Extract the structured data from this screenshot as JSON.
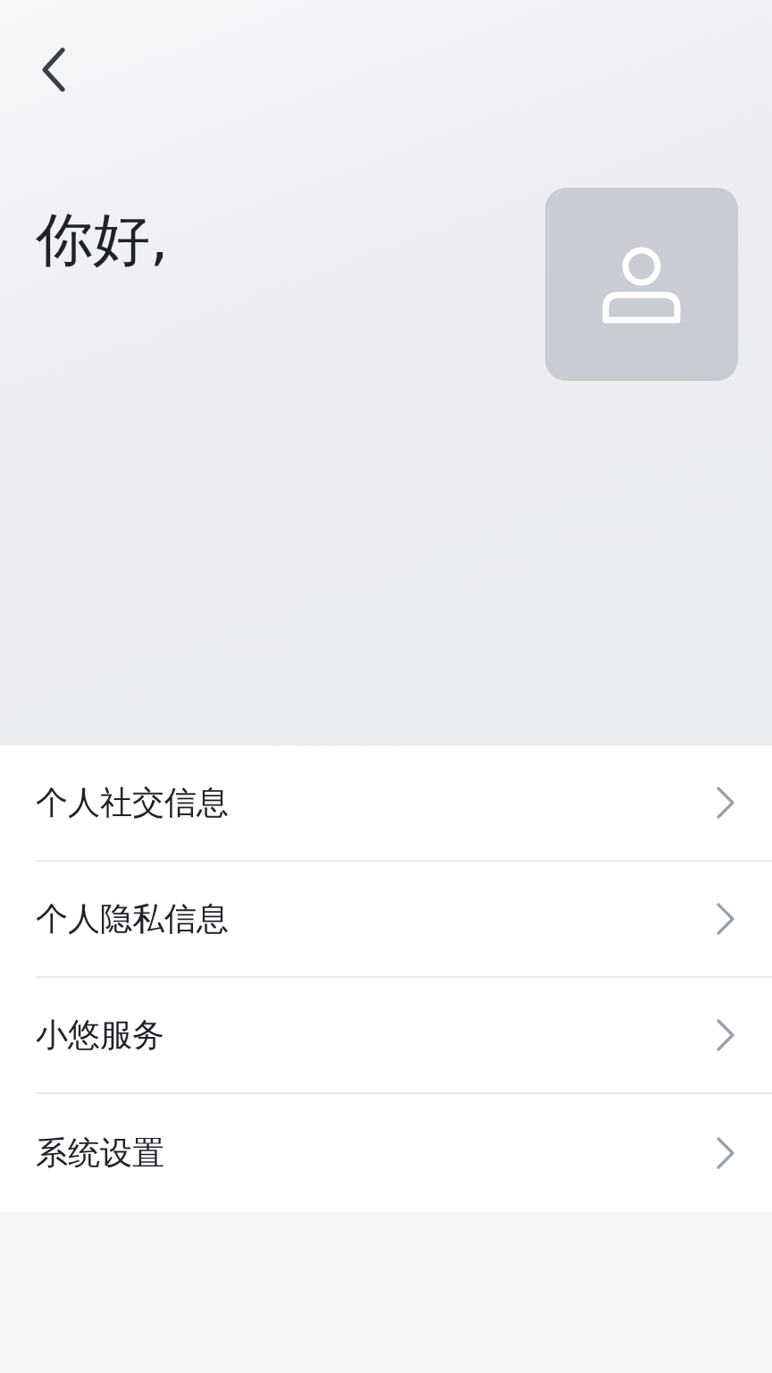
{
  "header": {
    "greeting": "你好,"
  },
  "menu": [
    {
      "label": "个人社交信息"
    },
    {
      "label": "个人隐私信息"
    },
    {
      "label": "小悠服务"
    },
    {
      "label": "系统设置"
    }
  ]
}
